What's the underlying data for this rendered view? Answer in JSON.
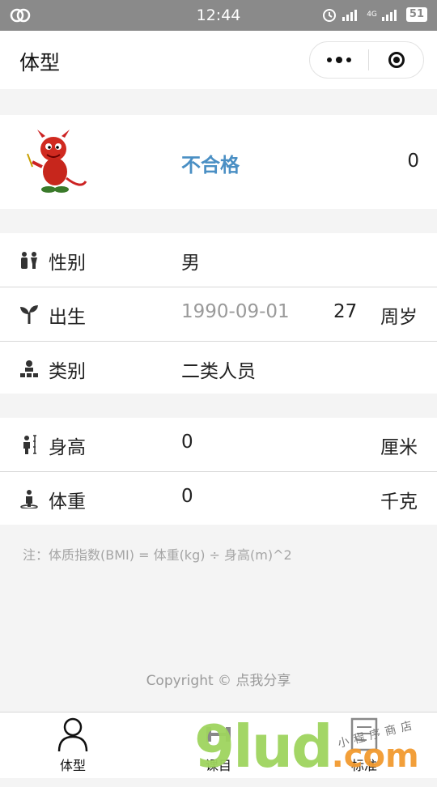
{
  "status_bar": {
    "time": "12:44",
    "network": "4G",
    "battery": "51"
  },
  "nav": {
    "title": "体型"
  },
  "profile": {
    "result": "不合格",
    "score": "0"
  },
  "info": {
    "gender_label": "性别",
    "gender_value": "男",
    "birth_label": "出生",
    "birth_value": "1990-09-01",
    "age": "27",
    "age_unit": "周岁",
    "category_label": "类别",
    "category_value": "二类人员"
  },
  "body": {
    "height_label": "身高",
    "height_value": "0",
    "height_unit": "厘米",
    "weight_label": "体重",
    "weight_value": "0",
    "weight_unit": "千克"
  },
  "note": "注：体质指数(BMI) = 体重(kg) ÷ 身高(m)^2",
  "copyright": "Copyright © 点我分享",
  "tabs": [
    {
      "label": "体型",
      "icon": "person-icon"
    },
    {
      "label": "课目",
      "icon": "dumbbell-icon"
    },
    {
      "label": "标准",
      "icon": "document-icon"
    }
  ],
  "watermark": {
    "main": "9lud",
    "suffix": ".com",
    "small": "小程序商店"
  }
}
